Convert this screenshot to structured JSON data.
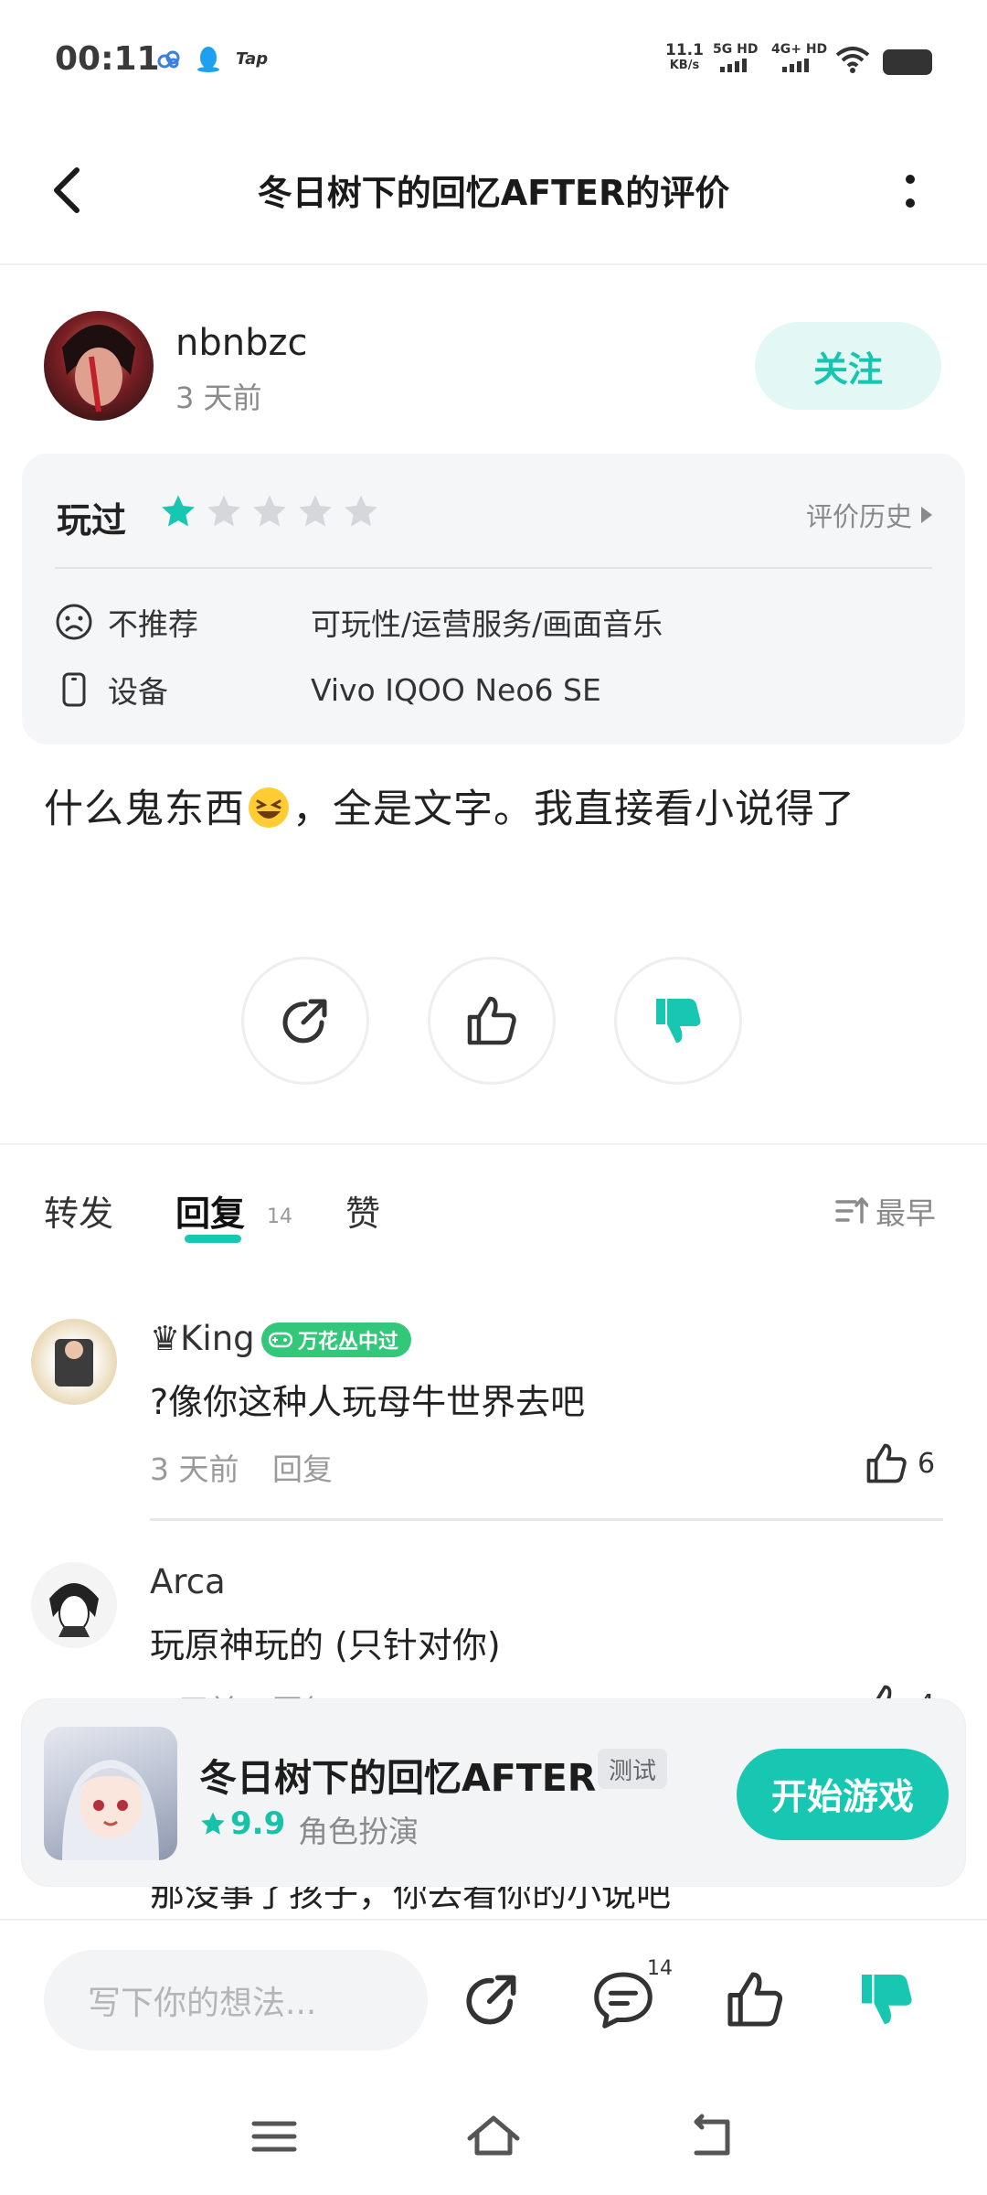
{
  "status_bar": {
    "time": "00:11",
    "tap_label": "Tap",
    "speed_value": "11.1",
    "speed_unit": "KB/s",
    "sim1": "5G HD",
    "sim2": "4G+ HD"
  },
  "header": {
    "title": "冬日树下的回忆AFTER的评价"
  },
  "author": {
    "name": "nbnbzc",
    "time": "3 天前",
    "follow_label": "关注"
  },
  "rating": {
    "played_label": "玩过",
    "stars": 1,
    "max_stars": 5,
    "history_label": "评价历史",
    "recommend_label": "不推荐",
    "recommend_value": "可玩性/运营服务/画面音乐",
    "device_label": "设备",
    "device_value": "Vivo IQOO Neo6 SE"
  },
  "review": {
    "text_before_emoji": "什么鬼东西",
    "emoji": "grinning-squinting-face",
    "text_after_emoji": "，全是文字。我直接看小说得了"
  },
  "tabs": [
    {
      "label": "转发"
    },
    {
      "label": "回复",
      "count": "14",
      "active": true
    },
    {
      "label": "赞"
    }
  ],
  "sort_label": "最早",
  "comments": [
    {
      "name": "♛King",
      "badge": "万花丛中过",
      "text": "?像你这种人玩母牛世界去吧",
      "time": "3 天前",
      "reply_label": "回复",
      "likes": "6"
    },
    {
      "name": "Arca",
      "text": "玩原神玩的 (只针对你)",
      "time": "3 天前",
      "reply_label": "回复",
      "likes": "4"
    }
  ],
  "partial_comment_text": "那没事了孩子，你去看你的小说吧",
  "game_card": {
    "name": "冬日树下的回忆AFTER",
    "tag": "测试",
    "score": "9.9",
    "genre": "角色扮演",
    "start_label": "开始游戏"
  },
  "bottom_bar": {
    "placeholder": "写下你的想法...",
    "comment_count": "14"
  },
  "colors": {
    "accent": "#18C7B2",
    "follow_bg": "#E3F7F5",
    "badge_green": "#33C77A",
    "card_bg": "#F5F6F8"
  }
}
